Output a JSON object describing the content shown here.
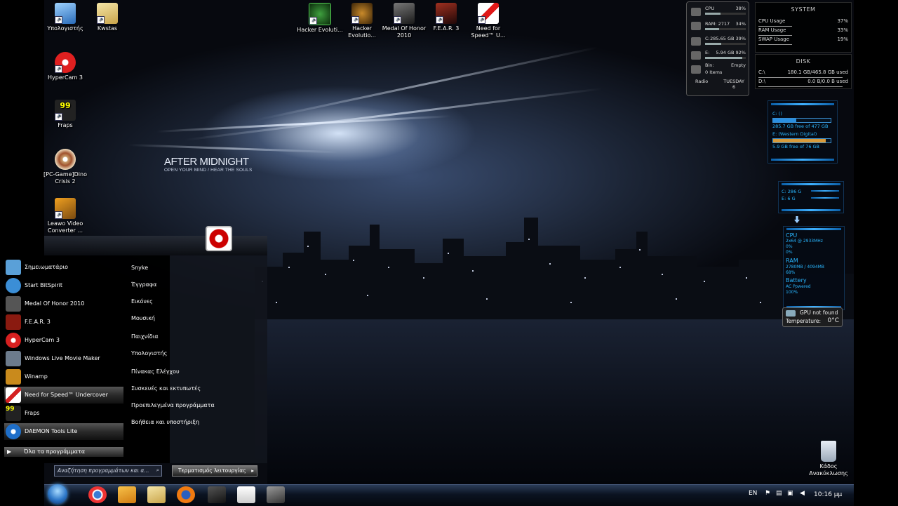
{
  "desktop": {
    "icons": [
      {
        "label": "Υπολογιστής",
        "icon": "computer-icon"
      },
      {
        "label": "Kwstas",
        "icon": "folder-icon"
      },
      {
        "label": "HyperCam 3",
        "icon": "hypercam-icon"
      },
      {
        "label": "Fraps",
        "icon": "fraps-icon"
      },
      {
        "label": "[PC-Game]Dino Crisis 2",
        "icon": "disc-icon"
      },
      {
        "label": "Leawo Video Converter ...",
        "icon": "converter-icon"
      },
      {
        "label": "Hacker Evoluti...",
        "icon": "hacker-evolution-icon"
      },
      {
        "label": "Hacker Evolutio...",
        "icon": "hacker-evolution-2-icon"
      },
      {
        "label": "Medal Of Honor 2010",
        "icon": "medal-of-honor-icon"
      },
      {
        "label": "F.E.A.R. 3",
        "icon": "fear3-icon"
      },
      {
        "label": "Need for Speed™ U...",
        "icon": "nfs-icon"
      }
    ],
    "recycle_bin": "Κάδος Ανακύκλωσης",
    "wallpaper_title": "AFTER MIDNIGHT",
    "wallpaper_subtitle": "OPEN YOUR MIND / HEAR THE SOULS"
  },
  "system_widget": {
    "cpu_label": "CPU",
    "cpu_value": "38%",
    "cpu_level": 0.38,
    "ram_label": "RAM: 2717",
    "ram_value": "34%",
    "ram_level": 0.34,
    "c_label": "C:",
    "c_value": "285.65 GB 39%",
    "c_level": 0.39,
    "e_label": "E:",
    "e_value": "5.94 GB 92%",
    "e_level": 0.92,
    "bin_label": "Bin:",
    "bin_value": "Empty",
    "bin_items": "0 Items",
    "radio_label": "Radio",
    "day": "TUESDAY",
    "date": "6"
  },
  "system_panel": {
    "title": "SYSTEM",
    "rows": [
      {
        "label": "CPU Usage",
        "value": "37%"
      },
      {
        "label": "RAM Usage",
        "value": "33%"
      },
      {
        "label": "SWAP Usage",
        "value": "19%"
      }
    ]
  },
  "disk_panel": {
    "title": "DISK",
    "rows": [
      {
        "label": "C:\\",
        "value": "180.1 GB/465.8 GB used"
      },
      {
        "label": "D:\\",
        "value": "0.0 B/0.0 B used"
      }
    ]
  },
  "drives_widget": {
    "c_label": "C: ()",
    "c_free": "285.7 GB free of 477 GB",
    "c_level": 0.4,
    "e_label": "E: (Western Digital)",
    "e_free": "5.9 GB free of 76 GB",
    "e_level": 0.92
  },
  "mini_drives": {
    "c": "C: 286 G",
    "e": "E: 6 G"
  },
  "hw_widget": {
    "cpu_title": "CPU",
    "cpu_spec": "2x64 @ 2933MHz",
    "core1": "0%",
    "core2": "0%",
    "ram_title": "RAM",
    "ram_spec": "2780MB / 4094MB",
    "ram_pct": "68%",
    "battery_title": "Battery",
    "battery_state": "AC Powered",
    "battery_pct": "100%"
  },
  "gpu_widget": {
    "status": "GPU not found",
    "temp_label": "Temperature:",
    "temp_value": "0°C"
  },
  "start_menu": {
    "programs": [
      {
        "label": "Σημειωματάριο",
        "color": "#5aa0d8"
      },
      {
        "label": "Start BitSpirit",
        "color": "#3b8ed6"
      },
      {
        "label": "Medal Of Honor 2010",
        "color": "#555"
      },
      {
        "label": "F.E.A.R. 3",
        "color": "#8a1a10"
      },
      {
        "label": "HyperCam 3",
        "color": "#d62020"
      },
      {
        "label": "Windows Live Movie Maker",
        "color": "#6c7b8c"
      },
      {
        "label": "Winamp",
        "color": "#c98a1c"
      },
      {
        "label": "Need for Speed™ Undercover",
        "color": "#d42020"
      },
      {
        "label": "Fraps",
        "color": "#d4d400"
      },
      {
        "label": "DAEMON Tools Lite",
        "color": "#1f6fc9"
      }
    ],
    "places": [
      "Snyke",
      "Έγγραφα",
      "Εικόνες",
      "Μουσική",
      "Παιχνίδια",
      "Υπολογιστής",
      "Πίνακας Ελέγχου",
      "Συσκευές και εκτυπωτές",
      "Προεπιλεγμένα προγράμματα",
      "Βοήθεια και υποστήριξη"
    ],
    "all_programs": "Όλα τα προγράμματα",
    "search_placeholder": "Αναζήτηση προγραμμάτων και α...",
    "shutdown": "Τερματισμός λειτουργίας"
  },
  "taskbar": {
    "pinned": [
      "chrome-icon",
      "media-player-icon",
      "explorer-icon",
      "firefox-icon",
      "hacker-icon",
      "notepad-icon",
      "game-icon"
    ],
    "lang": "EN",
    "clock": "10:16 μμ"
  }
}
